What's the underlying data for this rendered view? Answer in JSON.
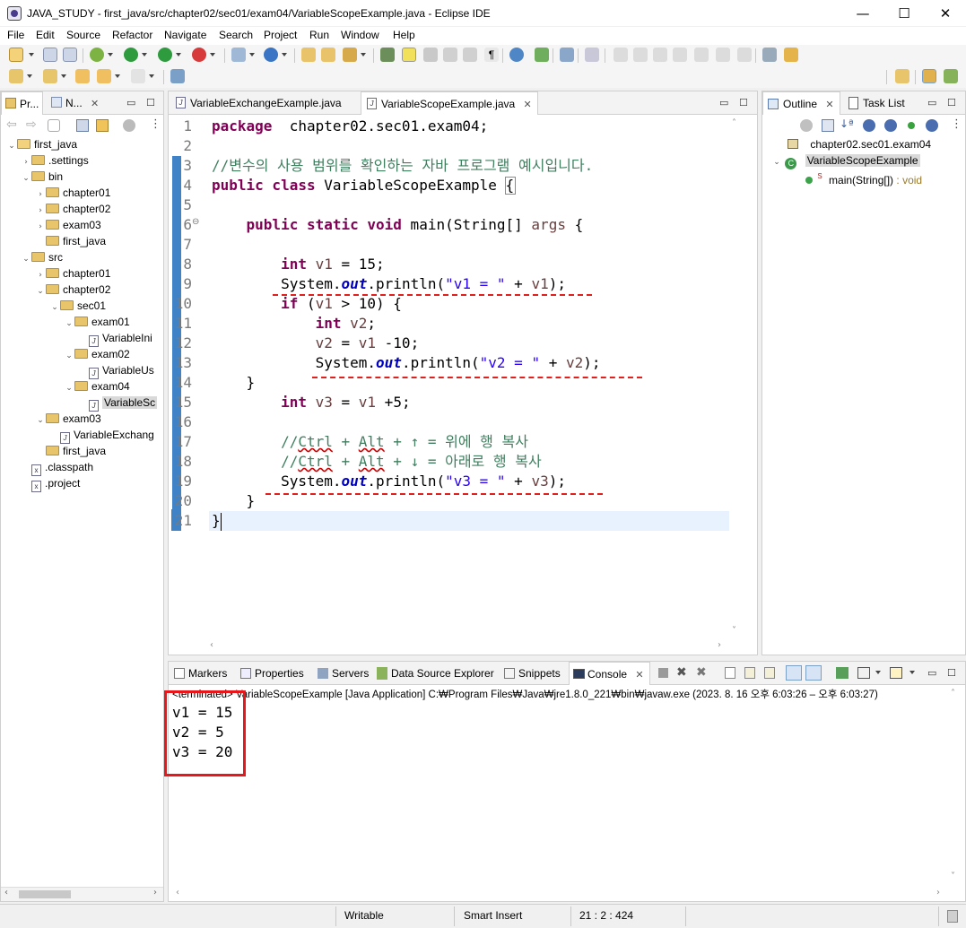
{
  "window": {
    "title": "JAVA_STUDY - first_java/src/chapter02/sec01/exam04/VariableScopeExample.java - Eclipse IDE",
    "minimize": "—",
    "maximize": "☐",
    "close": "✕"
  },
  "menubar": [
    "File",
    "Edit",
    "Source",
    "Refactor",
    "Navigate",
    "Search",
    "Project",
    "Run",
    "Window",
    "Help"
  ],
  "left_panel": {
    "tabs": [
      "Pr...",
      "N..."
    ],
    "tree": [
      {
        "label": "first_java",
        "kind": "project",
        "arrow": "⌄",
        "depth": 0
      },
      {
        "label": ".settings",
        "kind": "folder",
        "arrow": "›",
        "depth": 1
      },
      {
        "label": "bin",
        "kind": "folder",
        "arrow": "⌄",
        "depth": 1
      },
      {
        "label": "chapter01",
        "kind": "folder",
        "arrow": "›",
        "depth": 2
      },
      {
        "label": "chapter02",
        "kind": "folder",
        "arrow": "›",
        "depth": 2
      },
      {
        "label": "exam03",
        "kind": "folder",
        "arrow": "›",
        "depth": 2
      },
      {
        "label": "first_java",
        "kind": "folder",
        "arrow": "",
        "depth": 2
      },
      {
        "label": "src",
        "kind": "folder",
        "arrow": "⌄",
        "depth": 1
      },
      {
        "label": "chapter01",
        "kind": "folder",
        "arrow": "›",
        "depth": 2
      },
      {
        "label": "chapter02",
        "kind": "folder",
        "arrow": "⌄",
        "depth": 2
      },
      {
        "label": "sec01",
        "kind": "folder",
        "arrow": "⌄",
        "depth": 3
      },
      {
        "label": "exam01",
        "kind": "folder",
        "arrow": "⌄",
        "depth": 4
      },
      {
        "label": "VariableIni",
        "kind": "java",
        "arrow": "",
        "depth": 5
      },
      {
        "label": "exam02",
        "kind": "folder",
        "arrow": "⌄",
        "depth": 4
      },
      {
        "label": "VariableUs",
        "kind": "java",
        "arrow": "",
        "depth": 5
      },
      {
        "label": "exam04",
        "kind": "folder",
        "arrow": "⌄",
        "depth": 4
      },
      {
        "label": "VariableSc",
        "kind": "java",
        "arrow": "",
        "depth": 5,
        "selected": true
      },
      {
        "label": "exam03",
        "kind": "folder",
        "arrow": "⌄",
        "depth": 2
      },
      {
        "label": "VariableExchang",
        "kind": "java",
        "arrow": "",
        "depth": 3
      },
      {
        "label": "first_java",
        "kind": "folder",
        "arrow": "",
        "depth": 2
      },
      {
        "label": ".classpath",
        "kind": "xml",
        "arrow": "",
        "depth": 1
      },
      {
        "label": ".project",
        "kind": "xml",
        "arrow": "",
        "depth": 1
      }
    ]
  },
  "editor": {
    "tabs": [
      {
        "label": "VariableExchangeExample.java",
        "active": false
      },
      {
        "label": "VariableScopeExample.java",
        "active": true
      }
    ],
    "lines": [
      [
        [
          "kw",
          "package"
        ],
        [
          "",
          "  chapter02.sec01.exam04;"
        ]
      ],
      [],
      [
        [
          "cm",
          "//변수의 사용 범위를 확인하는 자바 프로그램 예시입니다."
        ]
      ],
      [
        [
          "kw",
          "public class"
        ],
        [
          "",
          " VariableScopeExample {"
        ]
      ],
      [],
      [
        [
          "",
          "    "
        ],
        [
          "kw",
          "public static void"
        ],
        [
          "",
          " main(String[] "
        ],
        [
          "var",
          "args"
        ],
        [
          "",
          " {"
        ]
      ],
      [],
      [
        [
          "",
          "        "
        ],
        [
          "kw",
          "int"
        ],
        [
          "",
          " "
        ],
        [
          "var",
          "v1"
        ],
        [
          "",
          " = 15;"
        ]
      ],
      [
        [
          "",
          "        System."
        ],
        [
          "fld",
          "out"
        ],
        [
          "",
          ".println("
        ],
        [
          "st",
          "\"v1 = \""
        ],
        [
          "",
          " + "
        ],
        [
          "var",
          "v1"
        ],
        [
          "",
          ");"
        ]
      ],
      [
        [
          "",
          "        "
        ],
        [
          "kw",
          "if"
        ],
        [
          "",
          " ("
        ],
        [
          "var",
          "v1"
        ],
        [
          "",
          " > 10) {"
        ]
      ],
      [
        [
          "",
          "            "
        ],
        [
          "kw",
          "int"
        ],
        [
          "",
          " "
        ],
        [
          "var",
          "v2"
        ],
        [
          "",
          ";"
        ]
      ],
      [
        [
          "",
          "            "
        ],
        [
          "var",
          "v2"
        ],
        [
          "",
          " = "
        ],
        [
          "var",
          "v1"
        ],
        [
          "",
          " -10;"
        ]
      ],
      [
        [
          "",
          "            System."
        ],
        [
          "fld",
          "out"
        ],
        [
          "",
          ".println("
        ],
        [
          "st",
          "\"v2 = \""
        ],
        [
          "",
          " + "
        ],
        [
          "var",
          "v2"
        ],
        [
          "",
          ");"
        ]
      ],
      [
        [
          "",
          "    }"
        ]
      ],
      [
        [
          "",
          "        "
        ],
        [
          "kw",
          "int"
        ],
        [
          "",
          " "
        ],
        [
          "var",
          "v3"
        ],
        [
          "",
          " = "
        ],
        [
          "var",
          "v1"
        ],
        [
          "",
          " +5;"
        ]
      ],
      [],
      [
        [
          "cm",
          "        //"
        ],
        [
          "cmu",
          "Ctrl"
        ],
        [
          "cm",
          " + "
        ],
        [
          "cmu",
          "Alt"
        ],
        [
          "cm",
          " + ↑ = 위에 행 복사"
        ]
      ],
      [
        [
          "cm",
          "        //"
        ],
        [
          "cmu",
          "Ctrl"
        ],
        [
          "cm",
          " + "
        ],
        [
          "cmu",
          "Alt"
        ],
        [
          "cm",
          " + ↓ = 아래로 행 복사"
        ]
      ],
      [
        [
          "",
          "        System."
        ],
        [
          "fld",
          "out"
        ],
        [
          "",
          ".println("
        ],
        [
          "st",
          "\"v3 = \""
        ],
        [
          "",
          " + "
        ],
        [
          "var",
          "v3"
        ],
        [
          "",
          ");"
        ]
      ],
      [
        [
          "",
          "    }"
        ]
      ],
      [
        [
          "",
          "}"
        ]
      ]
    ]
  },
  "outline": {
    "tabs": [
      "Outline",
      "Task List"
    ],
    "items": [
      {
        "label": "chapter02.sec01.exam04",
        "depth": 0
      },
      {
        "label": "VariableScopeExample",
        "depth": 0,
        "selected": true
      },
      {
        "label": "main(String[])",
        "suffix": " : void",
        "badge": "S",
        "depth": 1
      }
    ]
  },
  "bottom": {
    "tabs": [
      "Markers",
      "Properties",
      "Servers",
      "Data Source Explorer",
      "Snippets",
      "Console"
    ],
    "console_header": "<terminated> VariableScopeExample [Java Application] C:₩Program Files₩Java₩jre1.8.0_221₩bin₩javaw.exe  (2023. 8. 16 오후 6:03:26 – 오후 6:03:27)",
    "output": [
      "v1 = 15",
      "v2 = 5",
      "v3 = 20"
    ]
  },
  "status": {
    "writable": "Writable",
    "insert_mode": "Smart Insert",
    "position": "21 : 2 : 424"
  }
}
